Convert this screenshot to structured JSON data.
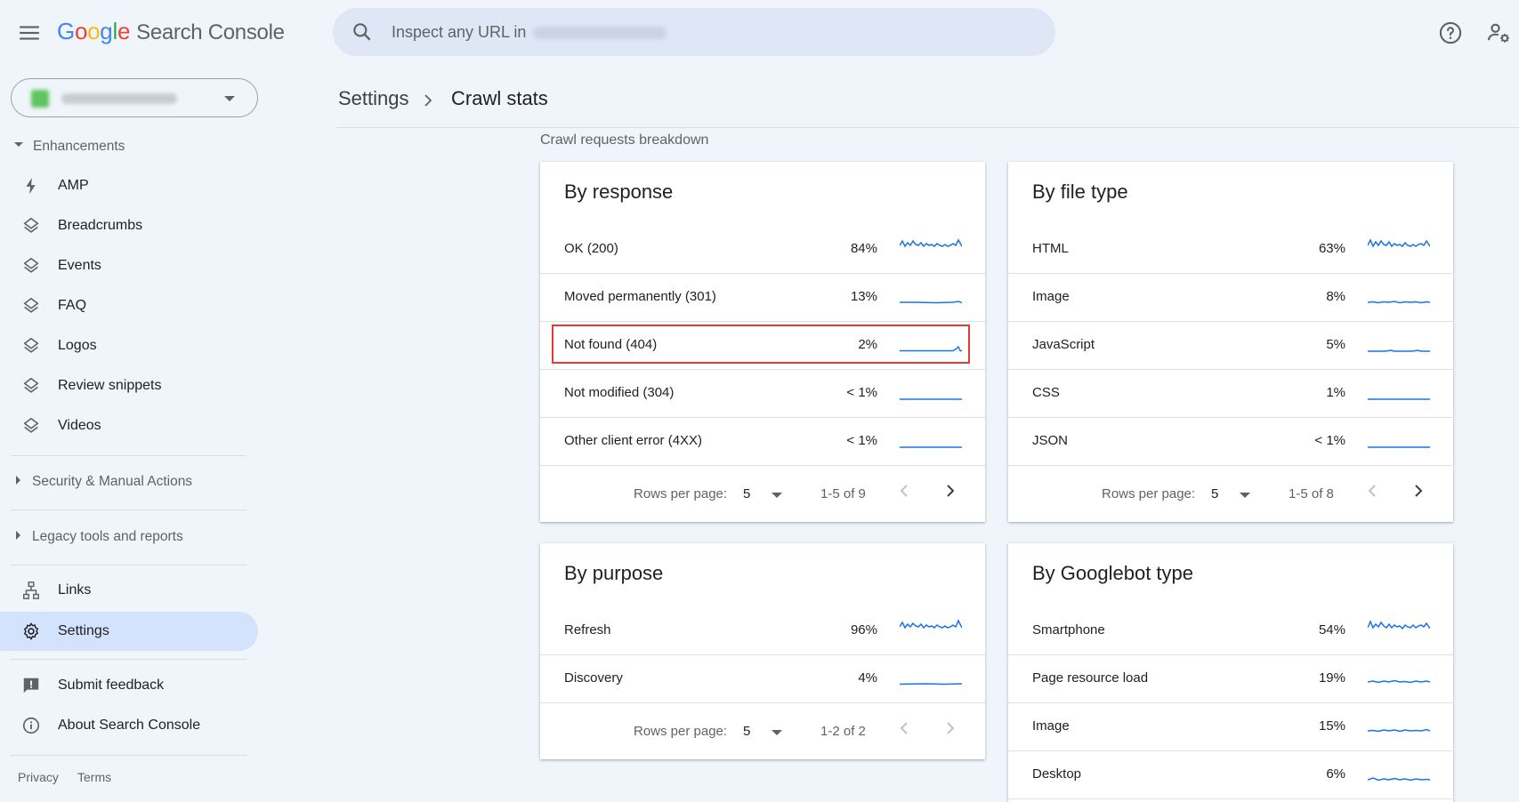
{
  "header": {
    "logo_google": [
      "G",
      "o",
      "o",
      "g",
      "l",
      "e"
    ],
    "product_name": "Search Console",
    "search_prefix": "Inspect any URL in"
  },
  "sidebar": {
    "enhancements_label": "Enhancements",
    "enhancement_items": [
      {
        "label": "AMP",
        "icon": "bolt-icon"
      },
      {
        "label": "Breadcrumbs",
        "icon": "layers-icon"
      },
      {
        "label": "Events",
        "icon": "layers-icon"
      },
      {
        "label": "FAQ",
        "icon": "layers-icon"
      },
      {
        "label": "Logos",
        "icon": "layers-icon"
      },
      {
        "label": "Review snippets",
        "icon": "layers-icon"
      },
      {
        "label": "Videos",
        "icon": "layers-icon"
      }
    ],
    "security_label": "Security & Manual Actions",
    "legacy_label": "Legacy tools and reports",
    "links_label": "Links",
    "settings_label": "Settings",
    "feedback_label": "Submit feedback",
    "about_label": "About Search Console",
    "footer": {
      "privacy": "Privacy",
      "terms": "Terms"
    }
  },
  "breadcrumb": {
    "parent": "Settings",
    "current": "Crawl stats"
  },
  "section_title": "Crawl requests breakdown",
  "pager_label": "Rows per page:",
  "cards": {
    "by_response": {
      "title": "By response",
      "rows": [
        {
          "label": "OK (200)",
          "pct": "84%"
        },
        {
          "label": "Moved permanently (301)",
          "pct": "13%"
        },
        {
          "label": "Not found (404)",
          "pct": "2%"
        },
        {
          "label": "Not modified (304)",
          "pct": "< 1%"
        },
        {
          "label": "Other client error (4XX)",
          "pct": "< 1%"
        }
      ],
      "rows_per_page": "5",
      "range": "1-5 of 9"
    },
    "by_file_type": {
      "title": "By file type",
      "rows": [
        {
          "label": "HTML",
          "pct": "63%"
        },
        {
          "label": "Image",
          "pct": "8%"
        },
        {
          "label": "JavaScript",
          "pct": "5%"
        },
        {
          "label": "CSS",
          "pct": "1%"
        },
        {
          "label": "JSON",
          "pct": "< 1%"
        }
      ],
      "rows_per_page": "5",
      "range": "1-5 of 8"
    },
    "by_purpose": {
      "title": "By purpose",
      "rows": [
        {
          "label": "Refresh",
          "pct": "96%"
        },
        {
          "label": "Discovery",
          "pct": "4%"
        }
      ],
      "rows_per_page": "5",
      "range": "1-2 of 2"
    },
    "by_googlebot": {
      "title": "By Googlebot type",
      "rows": [
        {
          "label": "Smartphone",
          "pct": "54%"
        },
        {
          "label": "Page resource load",
          "pct": "19%"
        },
        {
          "label": "Image",
          "pct": "15%"
        },
        {
          "label": "Desktop",
          "pct": "6%"
        }
      ]
    }
  },
  "colors": {
    "accent": "#1a73e8",
    "highlight": "#e53935",
    "active_nav": "#d3e3fd"
  }
}
